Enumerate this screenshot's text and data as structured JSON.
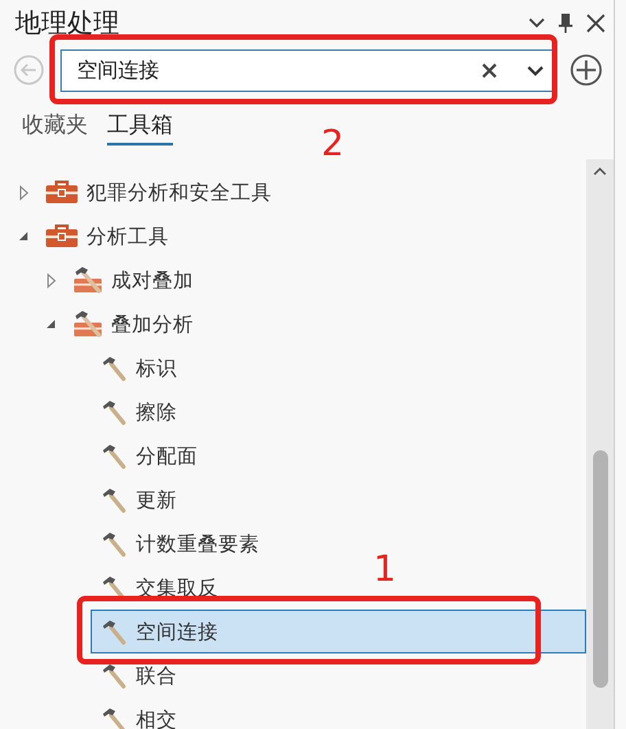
{
  "panel": {
    "title": "地理处理"
  },
  "search": {
    "value": "空间连接"
  },
  "tabs": [
    {
      "label": "收藏夹",
      "selected": false
    },
    {
      "label": "工具箱",
      "selected": true
    }
  ],
  "tree": [
    {
      "label": "犯罪分析和安全工具",
      "kind": "toolbox",
      "expanded": false
    },
    {
      "label": "分析工具",
      "kind": "toolbox",
      "expanded": true,
      "children": [
        {
          "label": "成对叠加",
          "kind": "toolset",
          "expanded": false
        },
        {
          "label": "叠加分析",
          "kind": "toolset",
          "expanded": true,
          "children": [
            {
              "label": "标识",
              "kind": "tool",
              "selected": false
            },
            {
              "label": "擦除",
              "kind": "tool",
              "selected": false
            },
            {
              "label": "分配面",
              "kind": "tool",
              "selected": false
            },
            {
              "label": "更新",
              "kind": "tool",
              "selected": false
            },
            {
              "label": "计数重叠要素",
              "kind": "tool",
              "selected": false
            },
            {
              "label": "交集取反",
              "kind": "tool",
              "selected": false
            },
            {
              "label": "空间连接",
              "kind": "tool",
              "selected": true
            },
            {
              "label": "联合",
              "kind": "tool",
              "selected": false
            },
            {
              "label": "相交",
              "kind": "tool",
              "selected": false
            }
          ]
        }
      ]
    }
  ],
  "annotations": [
    {
      "label": "2",
      "kind": "search"
    },
    {
      "label": "1",
      "kind": "selected-tool"
    }
  ]
}
